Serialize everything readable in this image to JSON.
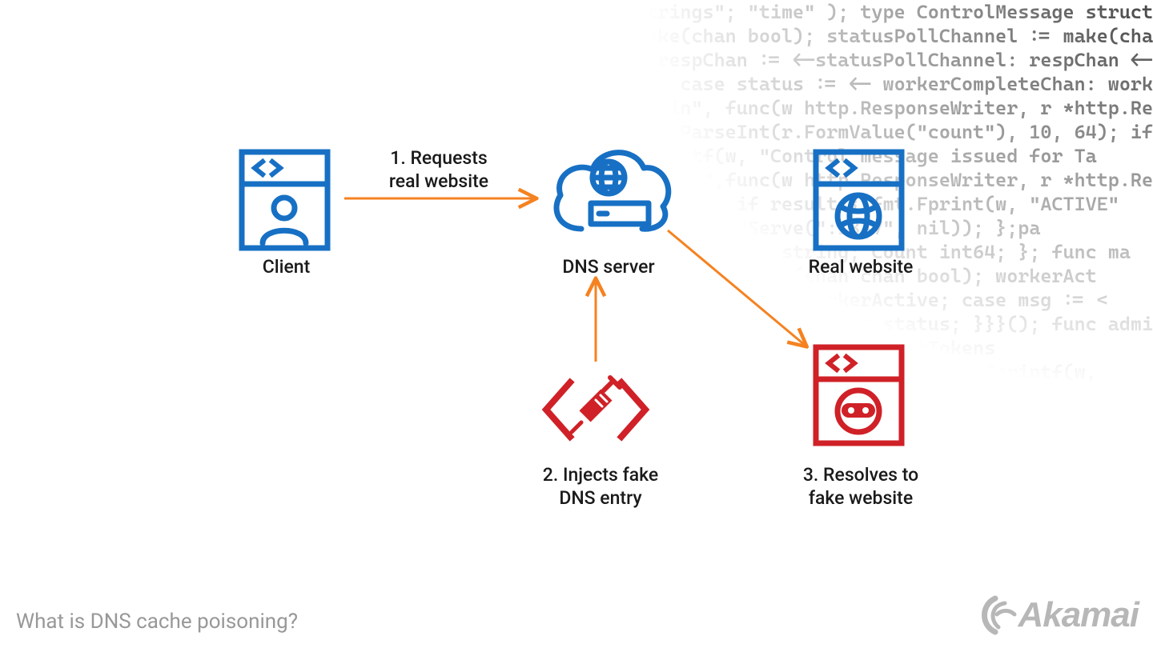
{
  "caption": "What is DNS cache poisoning?",
  "brand": "Akamai",
  "nodes": {
    "client": {
      "label": "Client"
    },
    "dns": {
      "label": "DNS server"
    },
    "real": {
      "label": "Real website"
    },
    "injector": {
      "label_line1": "2. Injects fake",
      "label_line2": "DNS entry"
    },
    "fake": {
      "label_line1": "3. Resolves to",
      "label_line2": "fake website"
    }
  },
  "arrows": {
    "a1": {
      "label_line1": "1. Requests",
      "label_line2": "real website"
    }
  },
  "colors": {
    "blue": "#1770c4",
    "red": "#cf2127",
    "orange": "#f58220",
    "grey": "#9a9a9a"
  },
  "code_bg": "\"encoding/json\"; \"strings\"; \"time\" ); type ControlMessage struct { Target string; Co\ncontrolChannel := make(chan bool); statusPollChannel := make(chan chan bool);\nfor { select { case respChan := <-statusPollChannel: respChan <- workerActive; case\ncontrolChannel.Count; case status := <- workerCompleteChan: workerActive = status;\nhttp.HandleFunc(\"/admin\", func(w http.ResponseWriter, r *http.Request) { hostTo\ncount, err := strconv.ParseInt(r.FormValue(\"count\"), 10, 64); if err != nil { fmt.Fprintf(w,\n}; cc <- msg; fmt.Fprintf(w, \"Control message issued for Ta\nhttp.HandleFunc(\"/status\",func(w http.ResponseWriter, r *http.Request) { reqChan\ncase result := <- reqChan: if result { fmt.Fprint(w, \"ACTIVE\"\n;});log.Fatal(http.ListenAndServe(\":1337\", nil)); };pa\nControlMessage struct { Target string; Count int64; }; func ma\nbool); statusPollChannel := make(chan chan bool); workerAct\n<-statusPollChannel: respChan <- workerActive; case msg := <\n= <- workerCompleteChan: workerActive = status; }}}(); func admin(\nhttp.ResponseWriter, r *http.Request) { hostTokens\nFormValue(\"count\"), 10, 64); if err != nil { fmt.Fprintf(w,\ncc <- msg; fmt.Fprintf(w, \"Control message issued for Ta\nfunc(w http.ResponseWriter, r *http.Request) { reqChan\n:= <- reqChan: if result { fmt.Fprint(w, \"ACTIVE\"\nlog.Fatal(http.ListenAndServe(\":1337\", nil)); };pa\n; \"net/http\"; \"strconv\"; \"strings\"; \"time\" ); type Con\ncontrolChannel := make(chan ControlMessage);workerAct\n{ case respChan := <-statusPollChannel: respChan <-\n<- workerCompleteChan: workerActive = status;\nr *http.Request) { hostTokens := strings.Split(r.H\n"
}
